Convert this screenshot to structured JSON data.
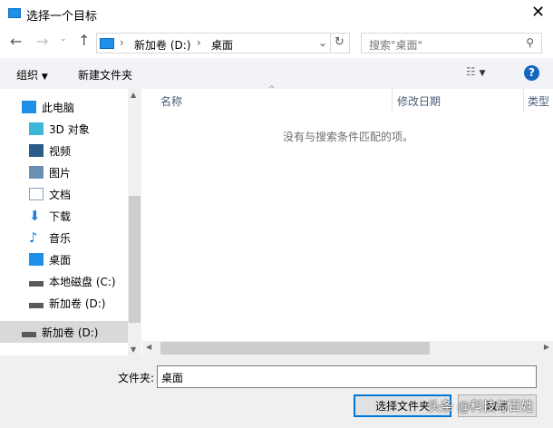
{
  "title": "选择一个目标",
  "nav": {
    "path": [
      "新加卷 (D:)",
      "桌面"
    ],
    "search_placeholder": "搜索\"桌面\""
  },
  "toolbar": {
    "organize": "组织",
    "new_folder": "新建文件夹",
    "help": "?"
  },
  "sidebar": {
    "items": [
      {
        "label": "此电脑",
        "icon": "computer-icon",
        "color": "#1e90e8"
      },
      {
        "label": "3D 对象",
        "icon": "cube-icon",
        "color": "#3bb7d8"
      },
      {
        "label": "视频",
        "icon": "video-icon",
        "color": "#2b5d8a"
      },
      {
        "label": "图片",
        "icon": "picture-icon",
        "color": "#6a8fb5"
      },
      {
        "label": "文档",
        "icon": "document-icon",
        "color": "#8aa0b8"
      },
      {
        "label": "下载",
        "icon": "download-icon",
        "color": "#1e7fd8"
      },
      {
        "label": "音乐",
        "icon": "music-icon",
        "color": "#1e7fd8"
      },
      {
        "label": "桌面",
        "icon": "desktop-icon",
        "color": "#1e90e8"
      },
      {
        "label": "本地磁盘 (C:)",
        "icon": "drive-icon",
        "color": "#5a5a5a"
      },
      {
        "label": "新加卷 (D:)",
        "icon": "drive-icon",
        "color": "#5a5a5a"
      }
    ],
    "selected": "新加卷 (D:)"
  },
  "columns": [
    "名称",
    "修改日期",
    "类型"
  ],
  "empty_message": "没有与搜索条件匹配的项。",
  "footer": {
    "folder_label": "文件夹:",
    "folder_value": "桌面",
    "select_button": "选择文件夹",
    "cancel_button": "取消"
  },
  "watermark": "头条 @科技与百姓"
}
